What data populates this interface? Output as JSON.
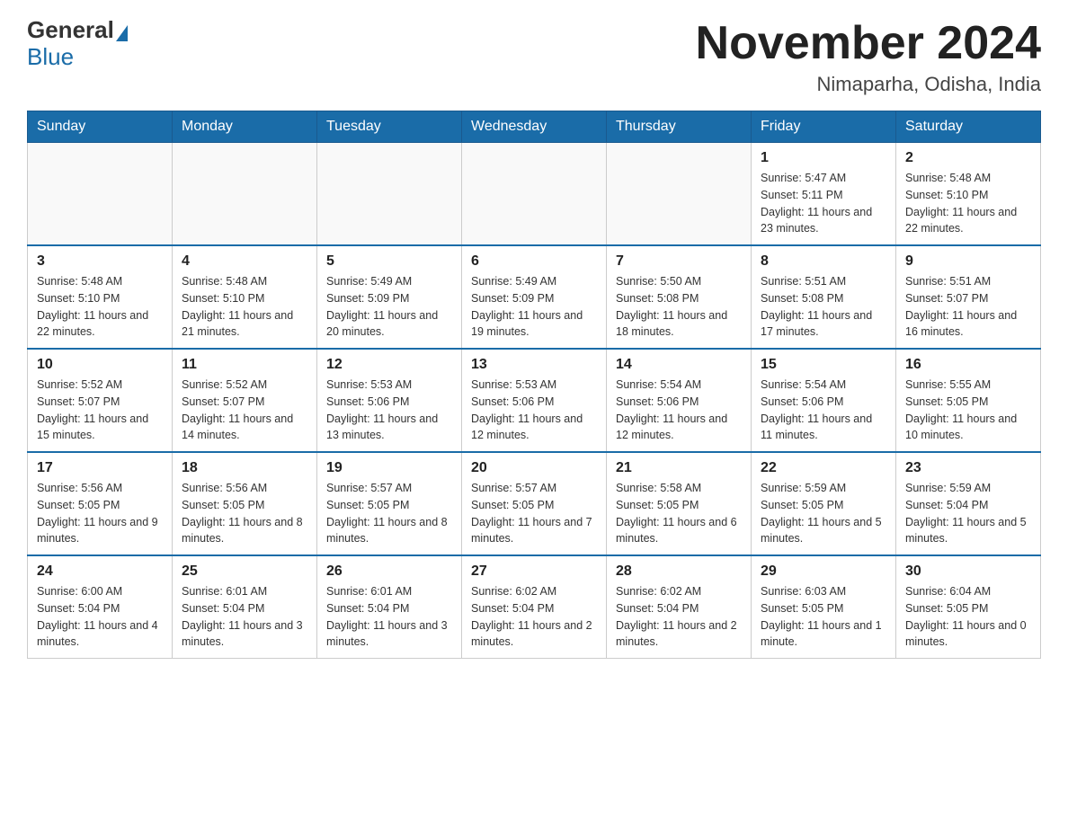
{
  "header": {
    "logo_general": "General",
    "logo_blue": "Blue",
    "title": "November 2024",
    "subtitle": "Nimaparha, Odisha, India"
  },
  "weekdays": [
    "Sunday",
    "Monday",
    "Tuesday",
    "Wednesday",
    "Thursday",
    "Friday",
    "Saturday"
  ],
  "weeks": [
    [
      {
        "day": "",
        "info": ""
      },
      {
        "day": "",
        "info": ""
      },
      {
        "day": "",
        "info": ""
      },
      {
        "day": "",
        "info": ""
      },
      {
        "day": "",
        "info": ""
      },
      {
        "day": "1",
        "info": "Sunrise: 5:47 AM\nSunset: 5:11 PM\nDaylight: 11 hours and 23 minutes."
      },
      {
        "day": "2",
        "info": "Sunrise: 5:48 AM\nSunset: 5:10 PM\nDaylight: 11 hours and 22 minutes."
      }
    ],
    [
      {
        "day": "3",
        "info": "Sunrise: 5:48 AM\nSunset: 5:10 PM\nDaylight: 11 hours and 22 minutes."
      },
      {
        "day": "4",
        "info": "Sunrise: 5:48 AM\nSunset: 5:10 PM\nDaylight: 11 hours and 21 minutes."
      },
      {
        "day": "5",
        "info": "Sunrise: 5:49 AM\nSunset: 5:09 PM\nDaylight: 11 hours and 20 minutes."
      },
      {
        "day": "6",
        "info": "Sunrise: 5:49 AM\nSunset: 5:09 PM\nDaylight: 11 hours and 19 minutes."
      },
      {
        "day": "7",
        "info": "Sunrise: 5:50 AM\nSunset: 5:08 PM\nDaylight: 11 hours and 18 minutes."
      },
      {
        "day": "8",
        "info": "Sunrise: 5:51 AM\nSunset: 5:08 PM\nDaylight: 11 hours and 17 minutes."
      },
      {
        "day": "9",
        "info": "Sunrise: 5:51 AM\nSunset: 5:07 PM\nDaylight: 11 hours and 16 minutes."
      }
    ],
    [
      {
        "day": "10",
        "info": "Sunrise: 5:52 AM\nSunset: 5:07 PM\nDaylight: 11 hours and 15 minutes."
      },
      {
        "day": "11",
        "info": "Sunrise: 5:52 AM\nSunset: 5:07 PM\nDaylight: 11 hours and 14 minutes."
      },
      {
        "day": "12",
        "info": "Sunrise: 5:53 AM\nSunset: 5:06 PM\nDaylight: 11 hours and 13 minutes."
      },
      {
        "day": "13",
        "info": "Sunrise: 5:53 AM\nSunset: 5:06 PM\nDaylight: 11 hours and 12 minutes."
      },
      {
        "day": "14",
        "info": "Sunrise: 5:54 AM\nSunset: 5:06 PM\nDaylight: 11 hours and 12 minutes."
      },
      {
        "day": "15",
        "info": "Sunrise: 5:54 AM\nSunset: 5:06 PM\nDaylight: 11 hours and 11 minutes."
      },
      {
        "day": "16",
        "info": "Sunrise: 5:55 AM\nSunset: 5:05 PM\nDaylight: 11 hours and 10 minutes."
      }
    ],
    [
      {
        "day": "17",
        "info": "Sunrise: 5:56 AM\nSunset: 5:05 PM\nDaylight: 11 hours and 9 minutes."
      },
      {
        "day": "18",
        "info": "Sunrise: 5:56 AM\nSunset: 5:05 PM\nDaylight: 11 hours and 8 minutes."
      },
      {
        "day": "19",
        "info": "Sunrise: 5:57 AM\nSunset: 5:05 PM\nDaylight: 11 hours and 8 minutes."
      },
      {
        "day": "20",
        "info": "Sunrise: 5:57 AM\nSunset: 5:05 PM\nDaylight: 11 hours and 7 minutes."
      },
      {
        "day": "21",
        "info": "Sunrise: 5:58 AM\nSunset: 5:05 PM\nDaylight: 11 hours and 6 minutes."
      },
      {
        "day": "22",
        "info": "Sunrise: 5:59 AM\nSunset: 5:05 PM\nDaylight: 11 hours and 5 minutes."
      },
      {
        "day": "23",
        "info": "Sunrise: 5:59 AM\nSunset: 5:04 PM\nDaylight: 11 hours and 5 minutes."
      }
    ],
    [
      {
        "day": "24",
        "info": "Sunrise: 6:00 AM\nSunset: 5:04 PM\nDaylight: 11 hours and 4 minutes."
      },
      {
        "day": "25",
        "info": "Sunrise: 6:01 AM\nSunset: 5:04 PM\nDaylight: 11 hours and 3 minutes."
      },
      {
        "day": "26",
        "info": "Sunrise: 6:01 AM\nSunset: 5:04 PM\nDaylight: 11 hours and 3 minutes."
      },
      {
        "day": "27",
        "info": "Sunrise: 6:02 AM\nSunset: 5:04 PM\nDaylight: 11 hours and 2 minutes."
      },
      {
        "day": "28",
        "info": "Sunrise: 6:02 AM\nSunset: 5:04 PM\nDaylight: 11 hours and 2 minutes."
      },
      {
        "day": "29",
        "info": "Sunrise: 6:03 AM\nSunset: 5:05 PM\nDaylight: 11 hours and 1 minute."
      },
      {
        "day": "30",
        "info": "Sunrise: 6:04 AM\nSunset: 5:05 PM\nDaylight: 11 hours and 0 minutes."
      }
    ]
  ]
}
